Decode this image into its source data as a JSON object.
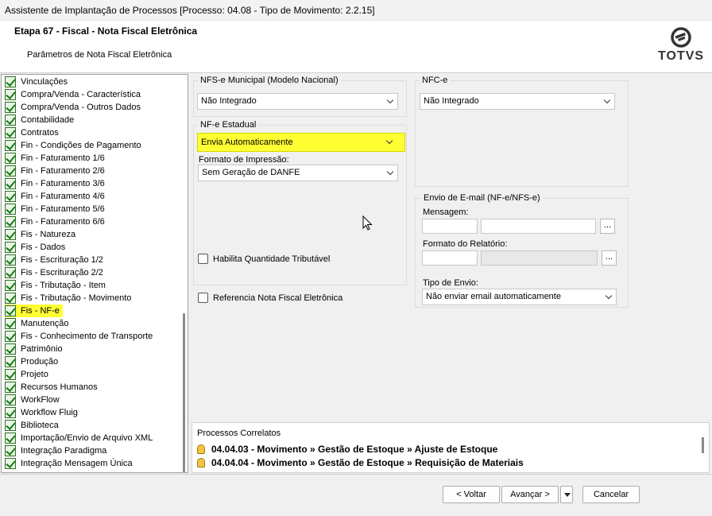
{
  "window": {
    "title": "Assistente de Implantação de Processos [Processo: 04.08 - Tipo de Movimento: 2.2.15]"
  },
  "header": {
    "step_title": "Etapa 67 - Fiscal - Nota Fiscal Eletrônica",
    "step_subtitle": "Parâmetros de Nota Fiscal Eletrônica",
    "logo_text": "TOTVS"
  },
  "tree": {
    "items": [
      "Vinculações",
      "Compra/Venda - Característica",
      "Compra/Venda - Outros Dados",
      "Contabilidade",
      "Contratos",
      "Fin - Condições de Pagamento",
      "Fin - Faturamento 1/6",
      "Fin - Faturamento 2/6",
      "Fin - Faturamento 3/6",
      "Fin - Faturamento 4/6",
      "Fin - Faturamento 5/6",
      "Fin - Faturamento 6/6",
      "Fis - Natureza",
      "Fis - Dados",
      "Fis - Escrituração 1/2",
      "Fis - Escrituração 2/2",
      "Fis - Tributação - Item",
      "Fis - Tributação - Movimento",
      "Fis - NF-e",
      "Manutenção",
      "Fis - Conhecimento de Transporte",
      "Patrimônio",
      "Produção",
      "Projeto",
      "Recursos Humanos",
      "WorkFlow",
      "Workflow Fluig",
      "Biblioteca",
      "Importação/Envio de Arquivo XML",
      "Integração Paradigma",
      "Integração Mensagem Única"
    ],
    "selected": "Fis - NF-e"
  },
  "nfse": {
    "label": "NFS-e Municipal (Modelo Nacional)",
    "value": "Não Integrado"
  },
  "nfce": {
    "label": "NFC-e",
    "value": "Não Integrado"
  },
  "nfe": {
    "label": "NF-e Estadual",
    "value": "Envia Automaticamente",
    "format_label": "Formato de Impressão:",
    "format_value": "Sem Geração de DANFE",
    "qty_checkbox": "Habilita Quantidade Tributável"
  },
  "ref_checkbox": "Referencia Nota Fiscal Eletrônica",
  "email": {
    "label": "Envio de E-mail (NF-e/NFS-e)",
    "message_label": "Mensagem:",
    "report_label": "Formato do Relatório:",
    "send_type_label": "Tipo de Envio:",
    "send_type_value": "Não enviar email automaticamente",
    "dots": "..."
  },
  "related": {
    "title": "Processos Correlatos",
    "rows": [
      "04.04.03 - Movimento » Gestão de Estoque » Ajuste de Estoque",
      "04.04.04 - Movimento » Gestão de Estoque » Requisição de Materiais"
    ]
  },
  "buttons": {
    "back": "< Voltar",
    "next": "Avançar >",
    "cancel": "Cancelar"
  }
}
